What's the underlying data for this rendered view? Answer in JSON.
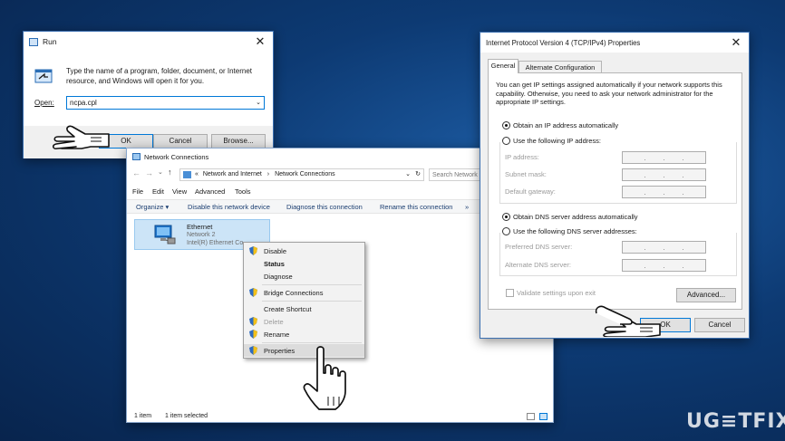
{
  "run": {
    "title": "Run",
    "description": "Type the name of a program, folder, document, or Internet resource, and Windows will open it for you.",
    "open_label": "Open:",
    "open_value": "ncpa.cpl",
    "ok": "OK",
    "cancel": "Cancel",
    "browse": "Browse..."
  },
  "netconn": {
    "title": "Network Connections",
    "address": [
      "«",
      "Network and Internet",
      "›",
      "Network Connections"
    ],
    "search_placeholder": "Search Network",
    "menu": [
      "File",
      "Edit",
      "View",
      "Advanced",
      "Tools"
    ],
    "commands": [
      "Organize ▾",
      "Disable this network device",
      "Diagnose this connection",
      "Rename this connection",
      "»"
    ],
    "adapter": {
      "name": "Ethernet",
      "network": "Network 2",
      "device": "Intel(R) Ethernet Co"
    },
    "status": {
      "count": "1 item",
      "selected": "1 item selected"
    }
  },
  "context_menu": {
    "items": [
      "Disable",
      "Status",
      "Diagnose",
      "Bridge Connections",
      "Create Shortcut",
      "Delete",
      "Rename",
      "Properties"
    ]
  },
  "ipv4": {
    "title": "Internet Protocol Version 4 (TCP/IPv4) Properties",
    "tabs": [
      "General",
      "Alternate Configuration"
    ],
    "description": "You can get IP settings assigned automatically if your network supports this capability. Otherwise, you need to ask your network administrator for the appropriate IP settings.",
    "obtain_ip": "Obtain an IP address automatically",
    "use_ip": "Use the following IP address:",
    "ip_address": "IP address:",
    "subnet_mask": "Subnet mask:",
    "default_gateway": "Default gateway:",
    "obtain_dns": "Obtain DNS server address automatically",
    "use_dns": "Use the following DNS server addresses:",
    "preferred_dns": "Preferred DNS server:",
    "alternate_dns": "Alternate DNS server:",
    "validate": "Validate settings upon exit",
    "advanced": "Advanced...",
    "ok": "OK",
    "cancel": "Cancel"
  },
  "watermark": "UG≡TFIX",
  "colors": {
    "accent": "#0078d7",
    "desktop": "#0d3a73"
  },
  "icons": [
    "run-icon",
    "network-icon",
    "shield-icon",
    "hand-cursor-icon",
    "close-icon",
    "refresh-icon"
  ]
}
